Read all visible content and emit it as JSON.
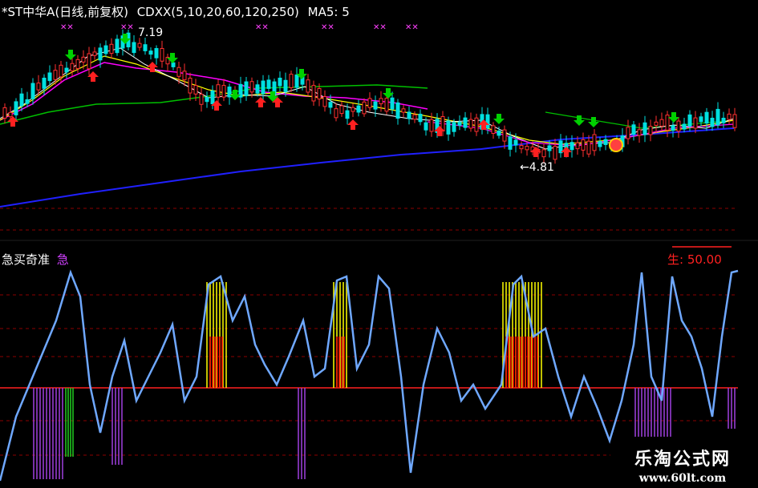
{
  "header": {
    "stock_name": "*ST中华A(日线,前复权)",
    "indicator": "CDXX(5,10,20,60,120,250)",
    "ma_label": "MA5: 5"
  },
  "price_labels": {
    "high": "7.19",
    "low": "4.81"
  },
  "sub_panel": {
    "title": "急买奇准",
    "title_tag": "急",
    "level_label": "生: 50.00"
  },
  "watermark": {
    "title": "乐淘公式网",
    "url": "www.60lt.com"
  },
  "colors": {
    "up": "#ff3030",
    "down": "#00e0e0",
    "ma5": "#ffffff",
    "ma10": "#ffff00",
    "ma20": "#ff00ff",
    "ma60": "#00c000",
    "ma250": "#2020ff",
    "oscillator": "#6fa8ff",
    "grid": "#8b0000",
    "buy_arrow": "#ff2020",
    "sell_arrow": "#00d000",
    "bar_yellow": "#ffff00",
    "bar_red": "#ff0000",
    "bar_purple": "#a040e0",
    "bar_green": "#20d020"
  }
}
